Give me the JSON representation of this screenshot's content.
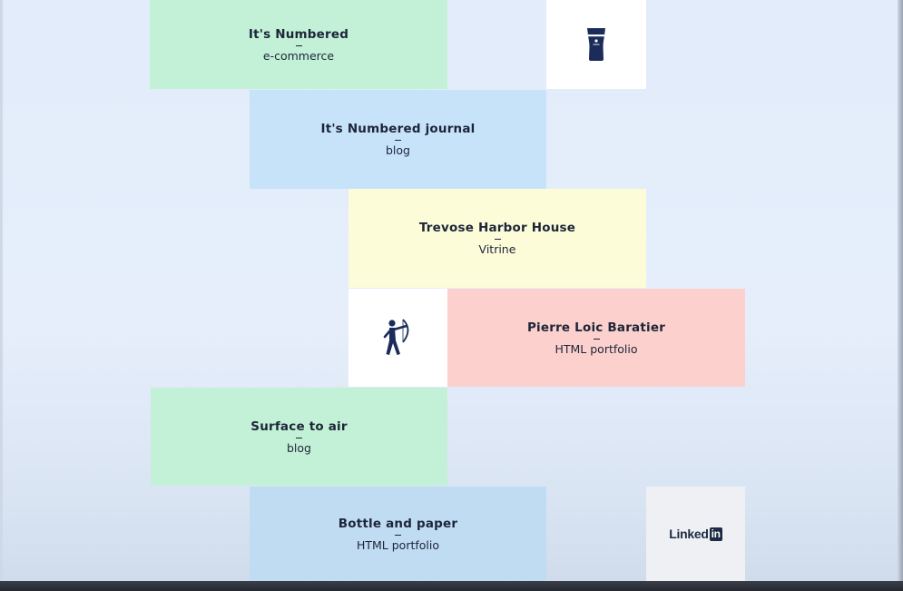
{
  "projects": [
    {
      "title": "It's Numbered",
      "type": "e-commerce",
      "color": "#c3f1d7"
    },
    {
      "title": "It's Numbered journal",
      "type": "blog",
      "color": "#c6e3fa"
    },
    {
      "title": "Trevose Harbor House",
      "type": "Vitrine",
      "color": "#fdfcd9"
    },
    {
      "title": "Pierre Loic Baratier",
      "type": "HTML portfolio",
      "color": "#fcd1cd"
    },
    {
      "title": "Surface to air",
      "type": "blog",
      "color": "#c3f1d7"
    },
    {
      "title": "Bottle and paper",
      "type": "HTML portfolio",
      "color": "#c0dcf3"
    }
  ],
  "icons": {
    "beer": "beer-glass-icon",
    "archer": "archer-icon",
    "linkedin": "linkedin-logo"
  },
  "linkedin": {
    "word": "Linked",
    "badge": "in"
  }
}
